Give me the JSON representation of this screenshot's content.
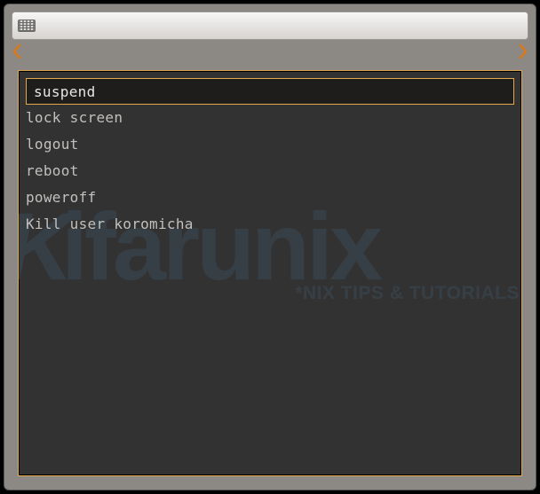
{
  "search": {
    "placeholder": "",
    "value": ""
  },
  "nav": {
    "left": "<",
    "right": ">"
  },
  "items": [
    {
      "label": "suspend"
    },
    {
      "label": "lock screen"
    },
    {
      "label": "logout"
    },
    {
      "label": "reboot"
    },
    {
      "label": "poweroff"
    },
    {
      "label": "Kill user koromicha"
    }
  ],
  "watermark": {
    "brand_k": "K",
    "brand_rest": "ifarunix",
    "tagline": "*NIX TIPS & TUTORIALS"
  },
  "colors": {
    "accent": "#e2a84a",
    "panel_bg": "#333232",
    "frame_bg": "#8c8884",
    "wm_color": "#3a4a58"
  }
}
